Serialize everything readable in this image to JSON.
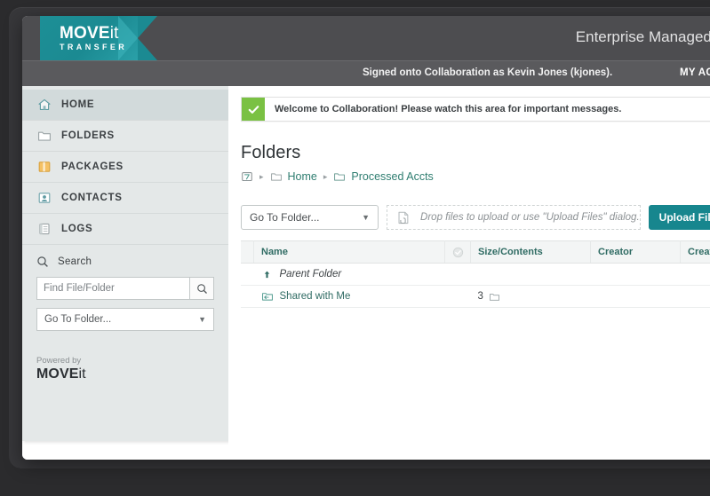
{
  "header": {
    "logo_primary": "MOVE",
    "logo_primary_suffix": "it",
    "logo_secondary": "TRANSFER",
    "app_title": "Enterprise Managed File",
    "signed_on_text": "Signed onto Collaboration as Kevin Jones (kjones).",
    "my_account_label": "MY ACCOUNT"
  },
  "sidebar": {
    "items": [
      {
        "label": "HOME",
        "icon": "home-icon",
        "active": true
      },
      {
        "label": "FOLDERS",
        "icon": "folder-icon",
        "active": false
      },
      {
        "label": "PACKAGES",
        "icon": "package-icon",
        "active": false
      },
      {
        "label": "CONTACTS",
        "icon": "contacts-icon",
        "active": false
      },
      {
        "label": "LOGS",
        "icon": "logs-icon",
        "active": false
      }
    ],
    "search": {
      "heading": "Search",
      "input_value": "",
      "input_placeholder": "Find File/Folder",
      "button_icon": "search-icon",
      "goto_folder_label": "Go To Folder..."
    },
    "powered_by": {
      "label": "Powered by",
      "logo_primary": "MOVE",
      "logo_primary_suffix": "it"
    }
  },
  "main": {
    "alert": {
      "icon": "check-icon",
      "message": "Welcome to Collaboration! Please watch this area for important messages.",
      "accent_color": "#7ac143"
    },
    "page_title": "Folders",
    "breadcrumb": {
      "root_icon": "root-folder-icon",
      "separator": "▸",
      "items": [
        {
          "label": "Home",
          "icon": "folder-icon"
        },
        {
          "label": "Processed Accts",
          "icon": "folder-icon"
        }
      ]
    },
    "toolbar": {
      "goto_folder_label": "Go To Folder...",
      "dropzone_icon": "drop-files-icon",
      "dropzone_text": "Drop files to upload or use \"Upload Files\" dialog.",
      "upload_button_label": "Upload Files",
      "upload_button_color": "#17868e"
    },
    "table": {
      "columns": [
        {
          "key": "grip",
          "label": ""
        },
        {
          "key": "name",
          "label": "Name"
        },
        {
          "key": "check",
          "label": "",
          "icon": "check-circle-icon"
        },
        {
          "key": "size",
          "label": "Size/Contents"
        },
        {
          "key": "creator",
          "label": "Creator"
        },
        {
          "key": "created",
          "label": "Created"
        }
      ],
      "rows": [
        {
          "type": "parent",
          "icon": "up-arrow-icon",
          "name": "Parent Folder",
          "size": "",
          "creator": "",
          "created": ""
        },
        {
          "type": "folder",
          "icon": "shared-folder-icon",
          "name": "Shared with Me",
          "size_count": "3",
          "size_icon": "folder-icon",
          "creator": "",
          "created": ""
        }
      ]
    },
    "pagination": {
      "button_icon": "page-icon"
    }
  }
}
